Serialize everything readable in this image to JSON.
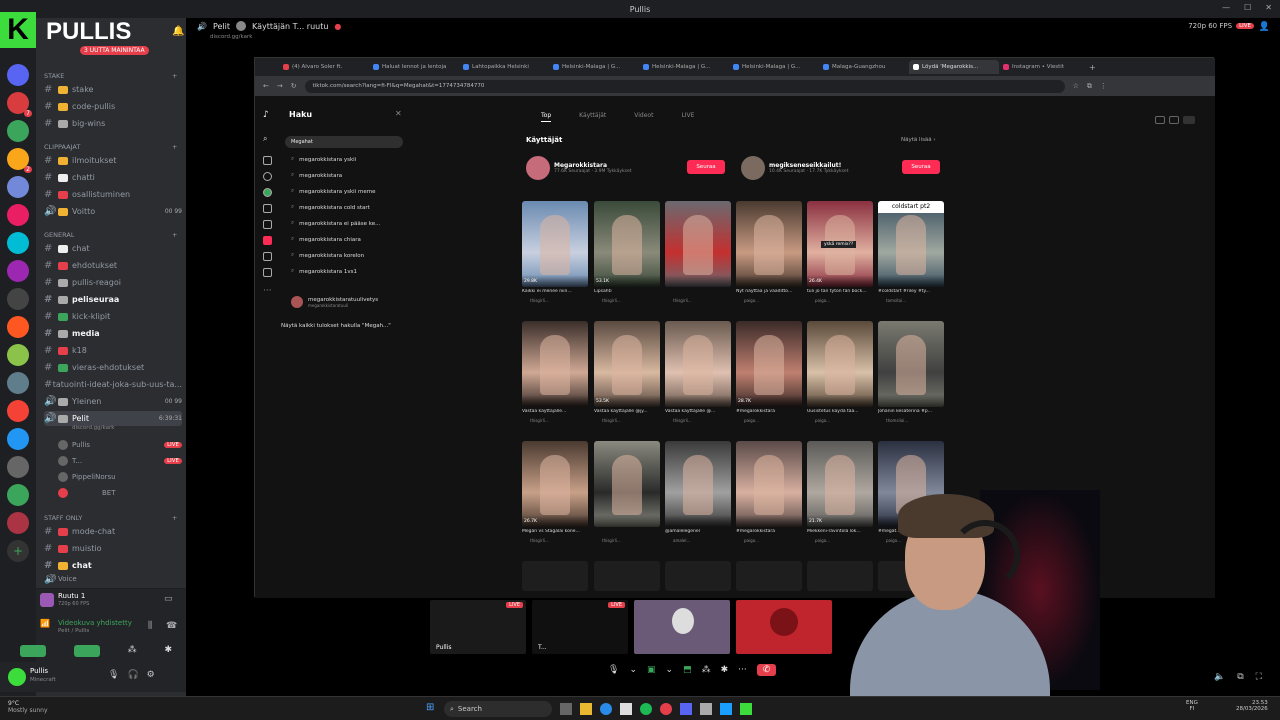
{
  "window": {
    "title": "Pullis"
  },
  "server": {
    "name": "PULLIS",
    "new_badge": "3 UUTTA MAININTAA"
  },
  "categories": [
    {
      "label": "Stake"
    },
    {
      "label": "CLIPPAAJAT"
    },
    {
      "label": "GENERAL"
    },
    {
      "label": "STAFF ONLY"
    }
  ],
  "channels": {
    "stake": [
      "stake",
      "code-pullis",
      "big-wins"
    ],
    "clip": [
      "ilmoitukset",
      "chatti",
      "osallistuminen",
      "Voitto"
    ],
    "general": [
      "chat",
      "ehdotukset",
      "pullis-reagoi",
      "peliseuraa",
      "kick-klipit",
      "media",
      "k18",
      "vieras-ehdotukset",
      "tatuointi-ideat-joka-sub-uus-ta...",
      "Yleinen",
      "Pelit"
    ],
    "staff": [
      "mode-chat",
      "muistio",
      "chat",
      "Voice"
    ]
  },
  "voice_counts": {
    "voitto": "00 99",
    "yleinen": "00 99",
    "pelit": "6:39:31"
  },
  "pelit_sub": "discord.gg/kark",
  "voice_users": [
    {
      "name": "Pullis",
      "live": "LIVE"
    },
    {
      "name": "T...",
      "live": "LIVE"
    },
    {
      "name": "PippeliNorsu",
      "live": ""
    },
    {
      "name": "BET",
      "live": ""
    }
  ],
  "voice_panel": {
    "stream": "Ruutu 1",
    "stream_sub": "720p 60 FPS",
    "status": "Videokuva yhdistetty",
    "location": "Pelit / Pullis"
  },
  "user_panel": {
    "name": "Pullis",
    "activity": "Minecraft"
  },
  "top_info": {
    "channel": "Pelit",
    "stream": "Käyttäjän T... ruutu",
    "invite": "discord.gg/kark",
    "fps": "720p 60 FPS",
    "live": "LIVE"
  },
  "browser": {
    "tabs": [
      "(4) Alvaro Soler ft.",
      "Haluat lennot ja lentoja",
      "Lahtopaikka Helsinki",
      "Helsinki-Malaga | G...",
      "Helsinki-Malaga | G...",
      "Helsinki-Malaga | G...",
      "Malaga-Guangzhou",
      "Löydä 'Megarokkis...",
      "Instagram • Viestit"
    ],
    "url": "tiktok.com/search?lang=fi-FI&q=Megahat&t=1774734784770"
  },
  "tiktok": {
    "search_title": "Haku",
    "search_value": "Megahat",
    "suggestions": [
      "megarokkistara yskii",
      "megarokkistara",
      "megarokkistara yskii meme",
      "megarokkistara cold start",
      "megarokkistara ei pääse ke...",
      "megarokkistara chiara",
      "megarokkistara korelon",
      "megarokkistara 1vs1"
    ],
    "suggest_user": "megarokkistaratuulivetys",
    "suggest_user_sub": "megarokkistaratuuli",
    "show_all": "Näytä kaikki tulokset hakulla \"Megah...\"",
    "tabs": [
      "Top",
      "Käyttäjät",
      "Videot",
      "LIVE"
    ],
    "section": "Käyttäjät",
    "show_more": "Näytä lisää",
    "users": [
      {
        "name": "Megarokkistara",
        "sub": "77.6K Seuraajat · 3.9M Tykkäykset",
        "follow": "Seuraa"
      },
      {
        "name": "megikseneseikkailut!",
        "sub": "10.4K Seuraajat · 17.7K Tykkäykset",
        "follow": "Seuraa"
      }
    ],
    "coldstart": "coldstart pt2",
    "yska": "yskä remix??",
    "videos": [
      {
        "cap": "Kaikki ei menee niin...",
        "user": "thisgirli..."
      },
      {
        "cap": "Lipsahti",
        "user": "thisgirli..."
      },
      {
        "cap": "",
        "user": "thisgirli..."
      },
      {
        "cap": "Nyt näyttää ja vaaditto...",
        "user": "paiga..."
      },
      {
        "cap": "tuli jo tän tytön fan bock...",
        "user": "paiga..."
      },
      {
        "cap": "#coldstart #riley #ty...",
        "user": "tomsitai..."
      },
      {
        "cap": "Vastaa käyttäjälle...",
        "user": "thisgirli..."
      },
      {
        "cap": "Vastaa käyttäjälle @jy...",
        "user": "thisgirli..."
      },
      {
        "cap": "Vastaa käyttäjälle @...",
        "user": "thisgirli..."
      },
      {
        "cap": "#megarokkistara",
        "user": "paiga..."
      },
      {
        "cap": "Uusistetus käydä tää...",
        "user": "paiga..."
      },
      {
        "cap": "Johanin kesäterina #p...",
        "user": "thomsilai..."
      },
      {
        "cap": "Megan vs Stagalai kone...",
        "user": "thisgirli..."
      },
      {
        "cap": "",
        "user": "thisgirli..."
      },
      {
        "cap": "@amalelegenel",
        "user": "amalel..."
      },
      {
        "cap": "#megarokkistara",
        "user": "paiga..."
      },
      {
        "cap": "Miekkeni-ravintola lok...",
        "user": "paiga..."
      },
      {
        "cap": "#megat...",
        "user": "paiga..."
      }
    ],
    "video_counts": [
      "29.8K",
      "53.1K",
      "",
      "",
      "26.4K",
      "",
      "",
      "53.5K",
      "",
      "28.7K",
      "",
      "",
      "26.7K",
      "",
      "",
      "",
      "21.7K",
      ""
    ]
  },
  "thumbs": [
    {
      "label": "Pullis",
      "live": "LIVE"
    },
    {
      "label": "T...",
      "live": "LIVE"
    },
    {
      "label": "",
      "live": ""
    },
    {
      "label": "",
      "live": ""
    }
  ],
  "taskbar": {
    "weather_temp": "9°C",
    "weather_desc": "Mostly sunny",
    "search": "Search",
    "lang1": "ENG",
    "lang2": "FI",
    "time": "23.53",
    "date": "28/03/2026"
  },
  "colors": {
    "accent": "#3ddc3d",
    "live": "#e43f4a",
    "tiktok": "#fe2c55"
  }
}
